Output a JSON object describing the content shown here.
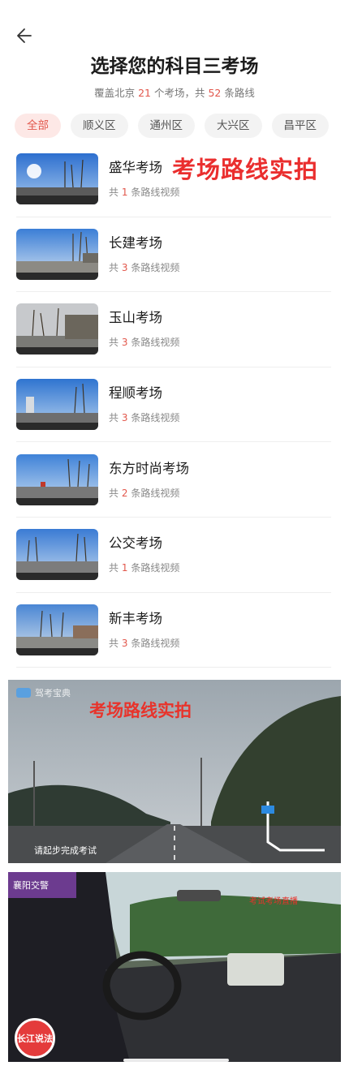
{
  "header": {
    "title": "选择您的科目三考场",
    "subtitle_prefix": "覆盖北京",
    "centers_count": "21",
    "subtitle_mid": "个考场，共",
    "routes_count": "52",
    "subtitle_suffix": "条路线"
  },
  "filters": [
    "全部",
    "顺义区",
    "通州区",
    "大兴区",
    "昌平区"
  ],
  "list_count_prefix": "共",
  "list_count_suffix": "条路线视频",
  "centers": [
    {
      "name": "盛华考场",
      "count": "1"
    },
    {
      "name": "长建考场",
      "count": "3"
    },
    {
      "name": "玉山考场",
      "count": "3"
    },
    {
      "name": "程顺考场",
      "count": "3"
    },
    {
      "name": "东方时尚考场",
      "count": "2"
    },
    {
      "name": "公交考场",
      "count": "1"
    },
    {
      "name": "新丰考场",
      "count": "3"
    }
  ],
  "overlay_text": "考场路线实拍",
  "banner1": {
    "logo_text": "驾考宝典",
    "title": "考场路线实拍",
    "caption": "请起步完成考试"
  },
  "banner2": {
    "tag": "襄阳交警",
    "live_text": "考试考场直播",
    "badge": "长江说法"
  }
}
